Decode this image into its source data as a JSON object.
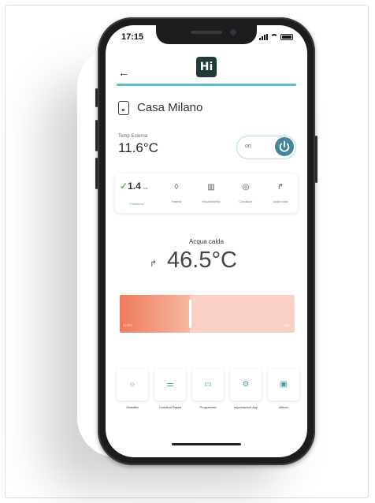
{
  "status": {
    "time": "17:15"
  },
  "app": {
    "logo_text": "Hi"
  },
  "house": {
    "name": "Casa Milano"
  },
  "outdoor": {
    "label": "Temp Esterna",
    "value": "11.6°C"
  },
  "power": {
    "state_label": "on",
    "is_on": true
  },
  "overview": {
    "pressure": {
      "check": "✓",
      "value": "1.4",
      "unit": "bar",
      "label": "Pressione"
    },
    "items": [
      {
        "icon": "flame-icon",
        "glyph": "◊",
        "label": "Fiamma"
      },
      {
        "icon": "radiator-icon",
        "glyph": "▥",
        "label": "Riscaldamento"
      },
      {
        "icon": "circulator-icon",
        "glyph": "◎",
        "label": "Circolatore"
      },
      {
        "icon": "faucet-icon",
        "glyph": "↱",
        "label": "Acqua calda"
      }
    ]
  },
  "hot_water": {
    "title": "Acqua calda",
    "icon_glyph": "↱",
    "temperature": "46.5°C",
    "range_min": "37.5°C",
    "range_max": "60°C",
    "setpoint_fraction": 0.4
  },
  "quick_actions": [
    {
      "icon": "sun-icon",
      "glyph": "☼",
      "label": "Modalità"
    },
    {
      "icon": "sliders-icon",
      "glyph": "⚌",
      "label": "Comandi Rapidi"
    },
    {
      "icon": "calendar-icon",
      "glyph": "▭",
      "label": "Programma"
    },
    {
      "icon": "settings-icon",
      "glyph": "⚙",
      "label": "Impostazioni App"
    },
    {
      "icon": "usage-icon",
      "glyph": "▣",
      "label": "Utilizzo"
    }
  ],
  "colors": {
    "accent": "#44859a",
    "header_line": "#6fb7c1",
    "slider_warm": "#ef7b5c",
    "slider_light": "#f8d1c4",
    "check_green": "#6cb85c"
  }
}
